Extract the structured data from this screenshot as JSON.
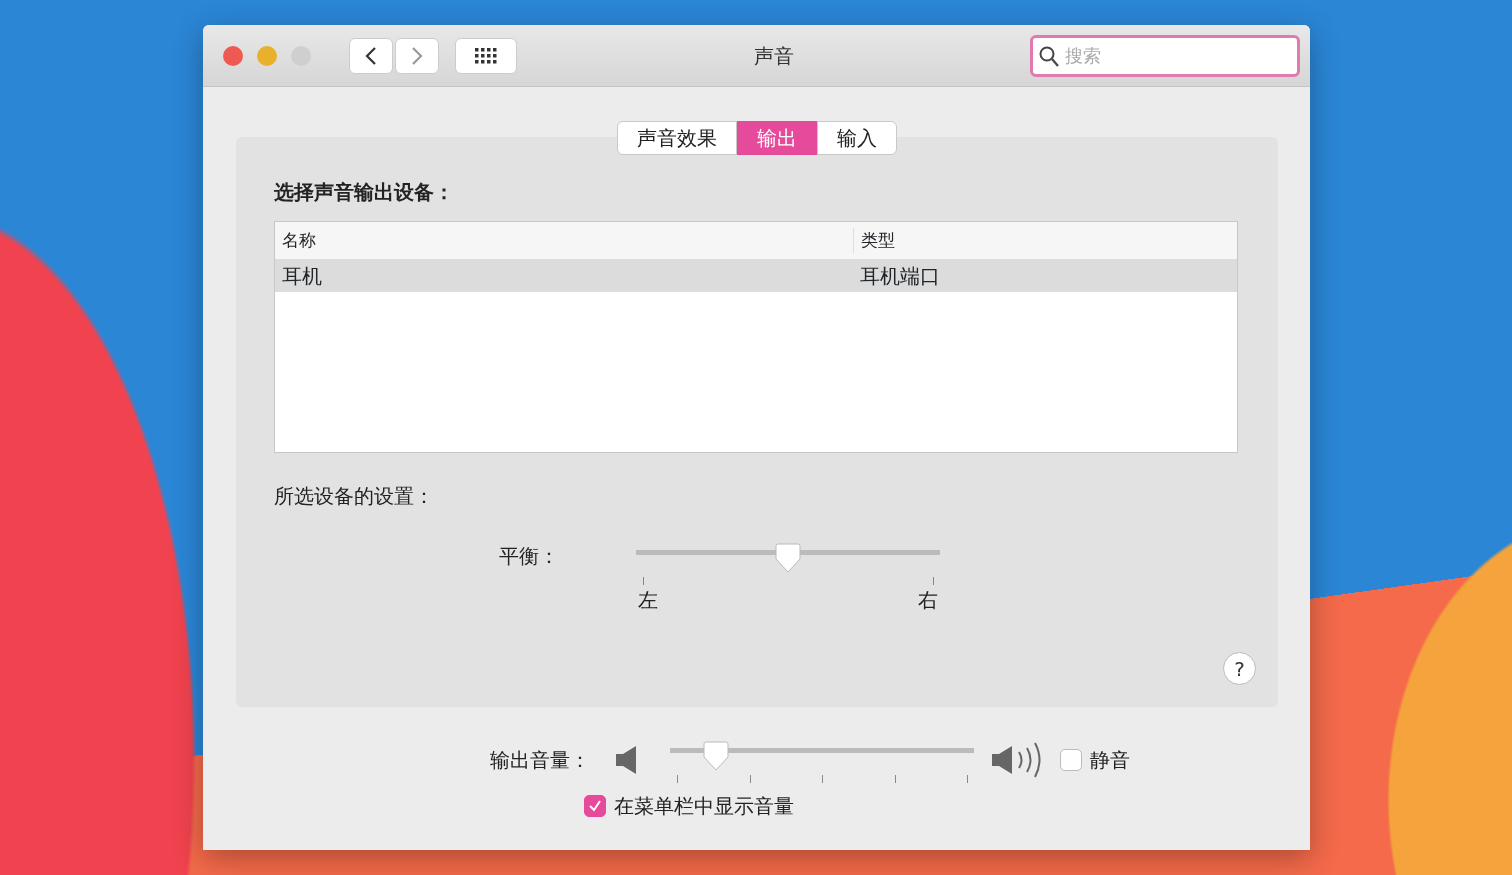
{
  "window": {
    "title": "声音"
  },
  "toolbar": {
    "search": {
      "placeholder": "搜索"
    }
  },
  "tabs": [
    {
      "label": "声音效果",
      "selected": false
    },
    {
      "label": "输出",
      "selected": true
    },
    {
      "label": "输入",
      "selected": false
    }
  ],
  "device_heading": "选择声音输出设备：",
  "table": {
    "columns": [
      "名称",
      "类型"
    ],
    "rows": [
      {
        "cells": [
          "耳机",
          "耳机端口"
        ],
        "selected": true
      }
    ]
  },
  "settings_heading": "所选设备的设置：",
  "balance": {
    "label": "平衡：",
    "level": 0.5,
    "left": "左",
    "right": "右"
  },
  "volume": {
    "label": "输出音量：",
    "level": 0.15
  },
  "help_button": {
    "label": "?"
  },
  "mute": {
    "label": "静音",
    "checked": false
  },
  "show_in_menu_bar": {
    "label": "在菜单栏中显示音量",
    "checked": true
  }
}
